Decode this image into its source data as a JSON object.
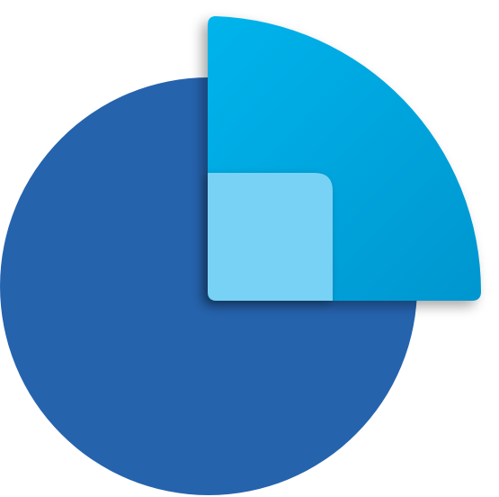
{
  "logo": {
    "icon": "quarter-circle-over-circle-icon",
    "colors": {
      "background": "#ffffff",
      "circle": "#2563ad",
      "quarter_light": "#00b4ec",
      "quarter_dark": "#0096cf",
      "inner_square": "#78d2f5",
      "shadow": "#0b2f5a"
    }
  }
}
